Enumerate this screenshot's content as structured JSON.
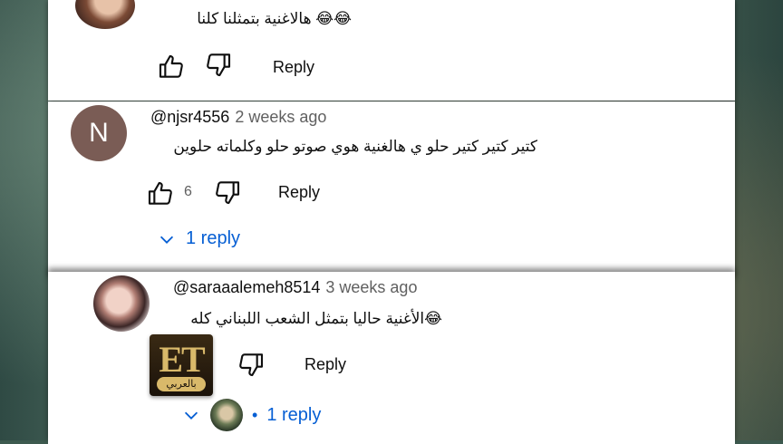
{
  "comments": [
    {
      "text": "😂😂 هالاغنية بتمثلنا كلنا",
      "reply_label": "Reply"
    },
    {
      "avatar_letter": "N",
      "handle": "@njsr4556",
      "time": "2 weeks ago",
      "text": "كتير كتير كتير حلو ي هالغنية هوي صوتو حلو وكلماته حلوين",
      "likes": "6",
      "reply_label": "Reply",
      "replies_label": "1 reply"
    },
    {
      "handle": "@saraaalemeh8514",
      "time": "3 weeks ago",
      "text": "😂الأغنية حاليا بتمثل الشعب اللبناني كله",
      "reply_label": "Reply",
      "replies_label": "1 reply"
    }
  ],
  "watermark": {
    "brand": "ET",
    "subtitle": "بالعربي"
  },
  "icons": {
    "like": "thumbs-up-icon",
    "dislike": "thumbs-down-icon",
    "expand": "chevron-down-icon"
  },
  "colors": {
    "link": "#065fd4",
    "text": "#0f0f0f",
    "meta": "#606060"
  }
}
